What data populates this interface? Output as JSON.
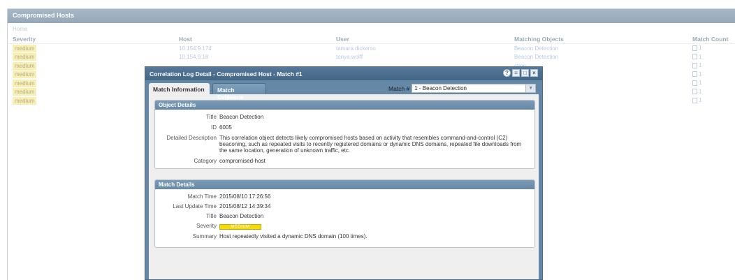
{
  "page": {
    "title": "Compromised Hosts",
    "breadcrumb": "Home",
    "columns": [
      "Severity",
      "Host",
      "User",
      "Matching Objects",
      "Match Count"
    ],
    "rows": [
      {
        "severity": "medium",
        "host": "10.154.9.174",
        "user": "tamara.dickerso",
        "object": "Beacon Detection",
        "count": "1"
      },
      {
        "severity": "medium",
        "host": "10.154.9.18",
        "user": "tonya.wolff",
        "object": "Beacon Detection",
        "count": "1"
      },
      {
        "severity": "medium",
        "host": "",
        "user": "",
        "object": "ction",
        "count": "1"
      },
      {
        "severity": "medium",
        "host": "",
        "user": "",
        "object": "ction",
        "count": "1"
      },
      {
        "severity": "medium",
        "host": "",
        "user": "",
        "object": "ction",
        "count": "1"
      },
      {
        "severity": "medium",
        "host": "",
        "user": "",
        "object": "ction",
        "count": "1"
      },
      {
        "severity": "medium",
        "host": "",
        "user": "",
        "object": "ction",
        "count": "1"
      }
    ]
  },
  "modal": {
    "title": "Correlation Log Detail - Compromised Host - Match #1",
    "tabs": [
      "Match Information",
      "Match Evidence"
    ],
    "match_label": "Match #",
    "match_value": "1 - Beacon Detection",
    "object_details": {
      "heading": "Object Details",
      "title_label": "Title",
      "title": "Beacon Detection",
      "id_label": "ID",
      "id": "6005",
      "desc_label": "Detailed Description",
      "desc": "This correlation object detects likely compromised hosts based on activity that resembles command-and-control (C2) beaconing, such as repeated visits to recently registered domains or dynamic DNS domains, repeated file downloads from the same location, generation of unknown traffic, etc.",
      "category_label": "Category",
      "category": "compromised-host"
    },
    "match_details": {
      "heading": "Match Details",
      "match_time_label": "Match Time",
      "match_time": "2015/08/10 17:26:56",
      "update_label": "Last Update Time",
      "update_time": "2015/08/12 14:39:34",
      "title_label": "Title",
      "title": "Beacon Detection",
      "severity_label": "Severity",
      "severity": "MEDIUM",
      "summary_label": "Summary",
      "summary": "Host repeatedly visited a dynamic DNS domain (100 times)."
    }
  },
  "colors": {
    "severity_medium": "#f3d90b",
    "modal_frame": "#6488a6"
  }
}
